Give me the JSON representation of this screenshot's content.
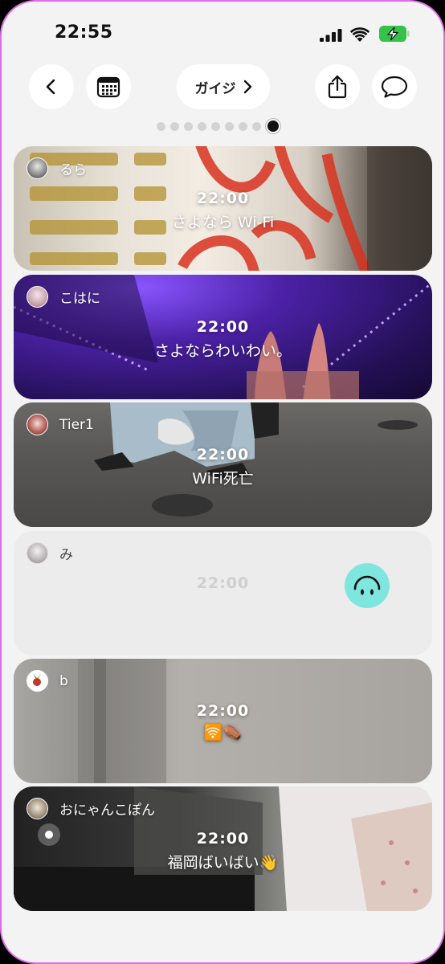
{
  "status_bar": {
    "time": "22:55"
  },
  "header": {
    "title": "ガイジ"
  },
  "pager": {
    "count": 9,
    "active_index": 8
  },
  "posts": [
    {
      "user": "るら",
      "time": "22:00",
      "message": "さよなら Wi-Fi"
    },
    {
      "user": "こはに",
      "time": "22:00",
      "message": "さよならわいわい。"
    },
    {
      "user": "Tier1",
      "time": "22:00",
      "message": "WiFi死亡"
    },
    {
      "user": "み",
      "time": "22:00",
      "message": ""
    },
    {
      "user": "b",
      "time": "22:00",
      "message": "🛜⚰️"
    },
    {
      "user": "おにゃんこぽん",
      "time": "22:00",
      "message": "福岡ばいばい👋"
    }
  ],
  "colors": {
    "frame": "#e06ae8",
    "battery": "#35c24a",
    "smiley": "#7fe6df"
  },
  "icons": [
    "back-icon",
    "calendar-icon",
    "chevron-right-icon",
    "share-icon",
    "comment-icon",
    "cellular-signal-icon",
    "wifi-icon",
    "battery-charging-icon",
    "smiley-reaction-icon"
  ]
}
